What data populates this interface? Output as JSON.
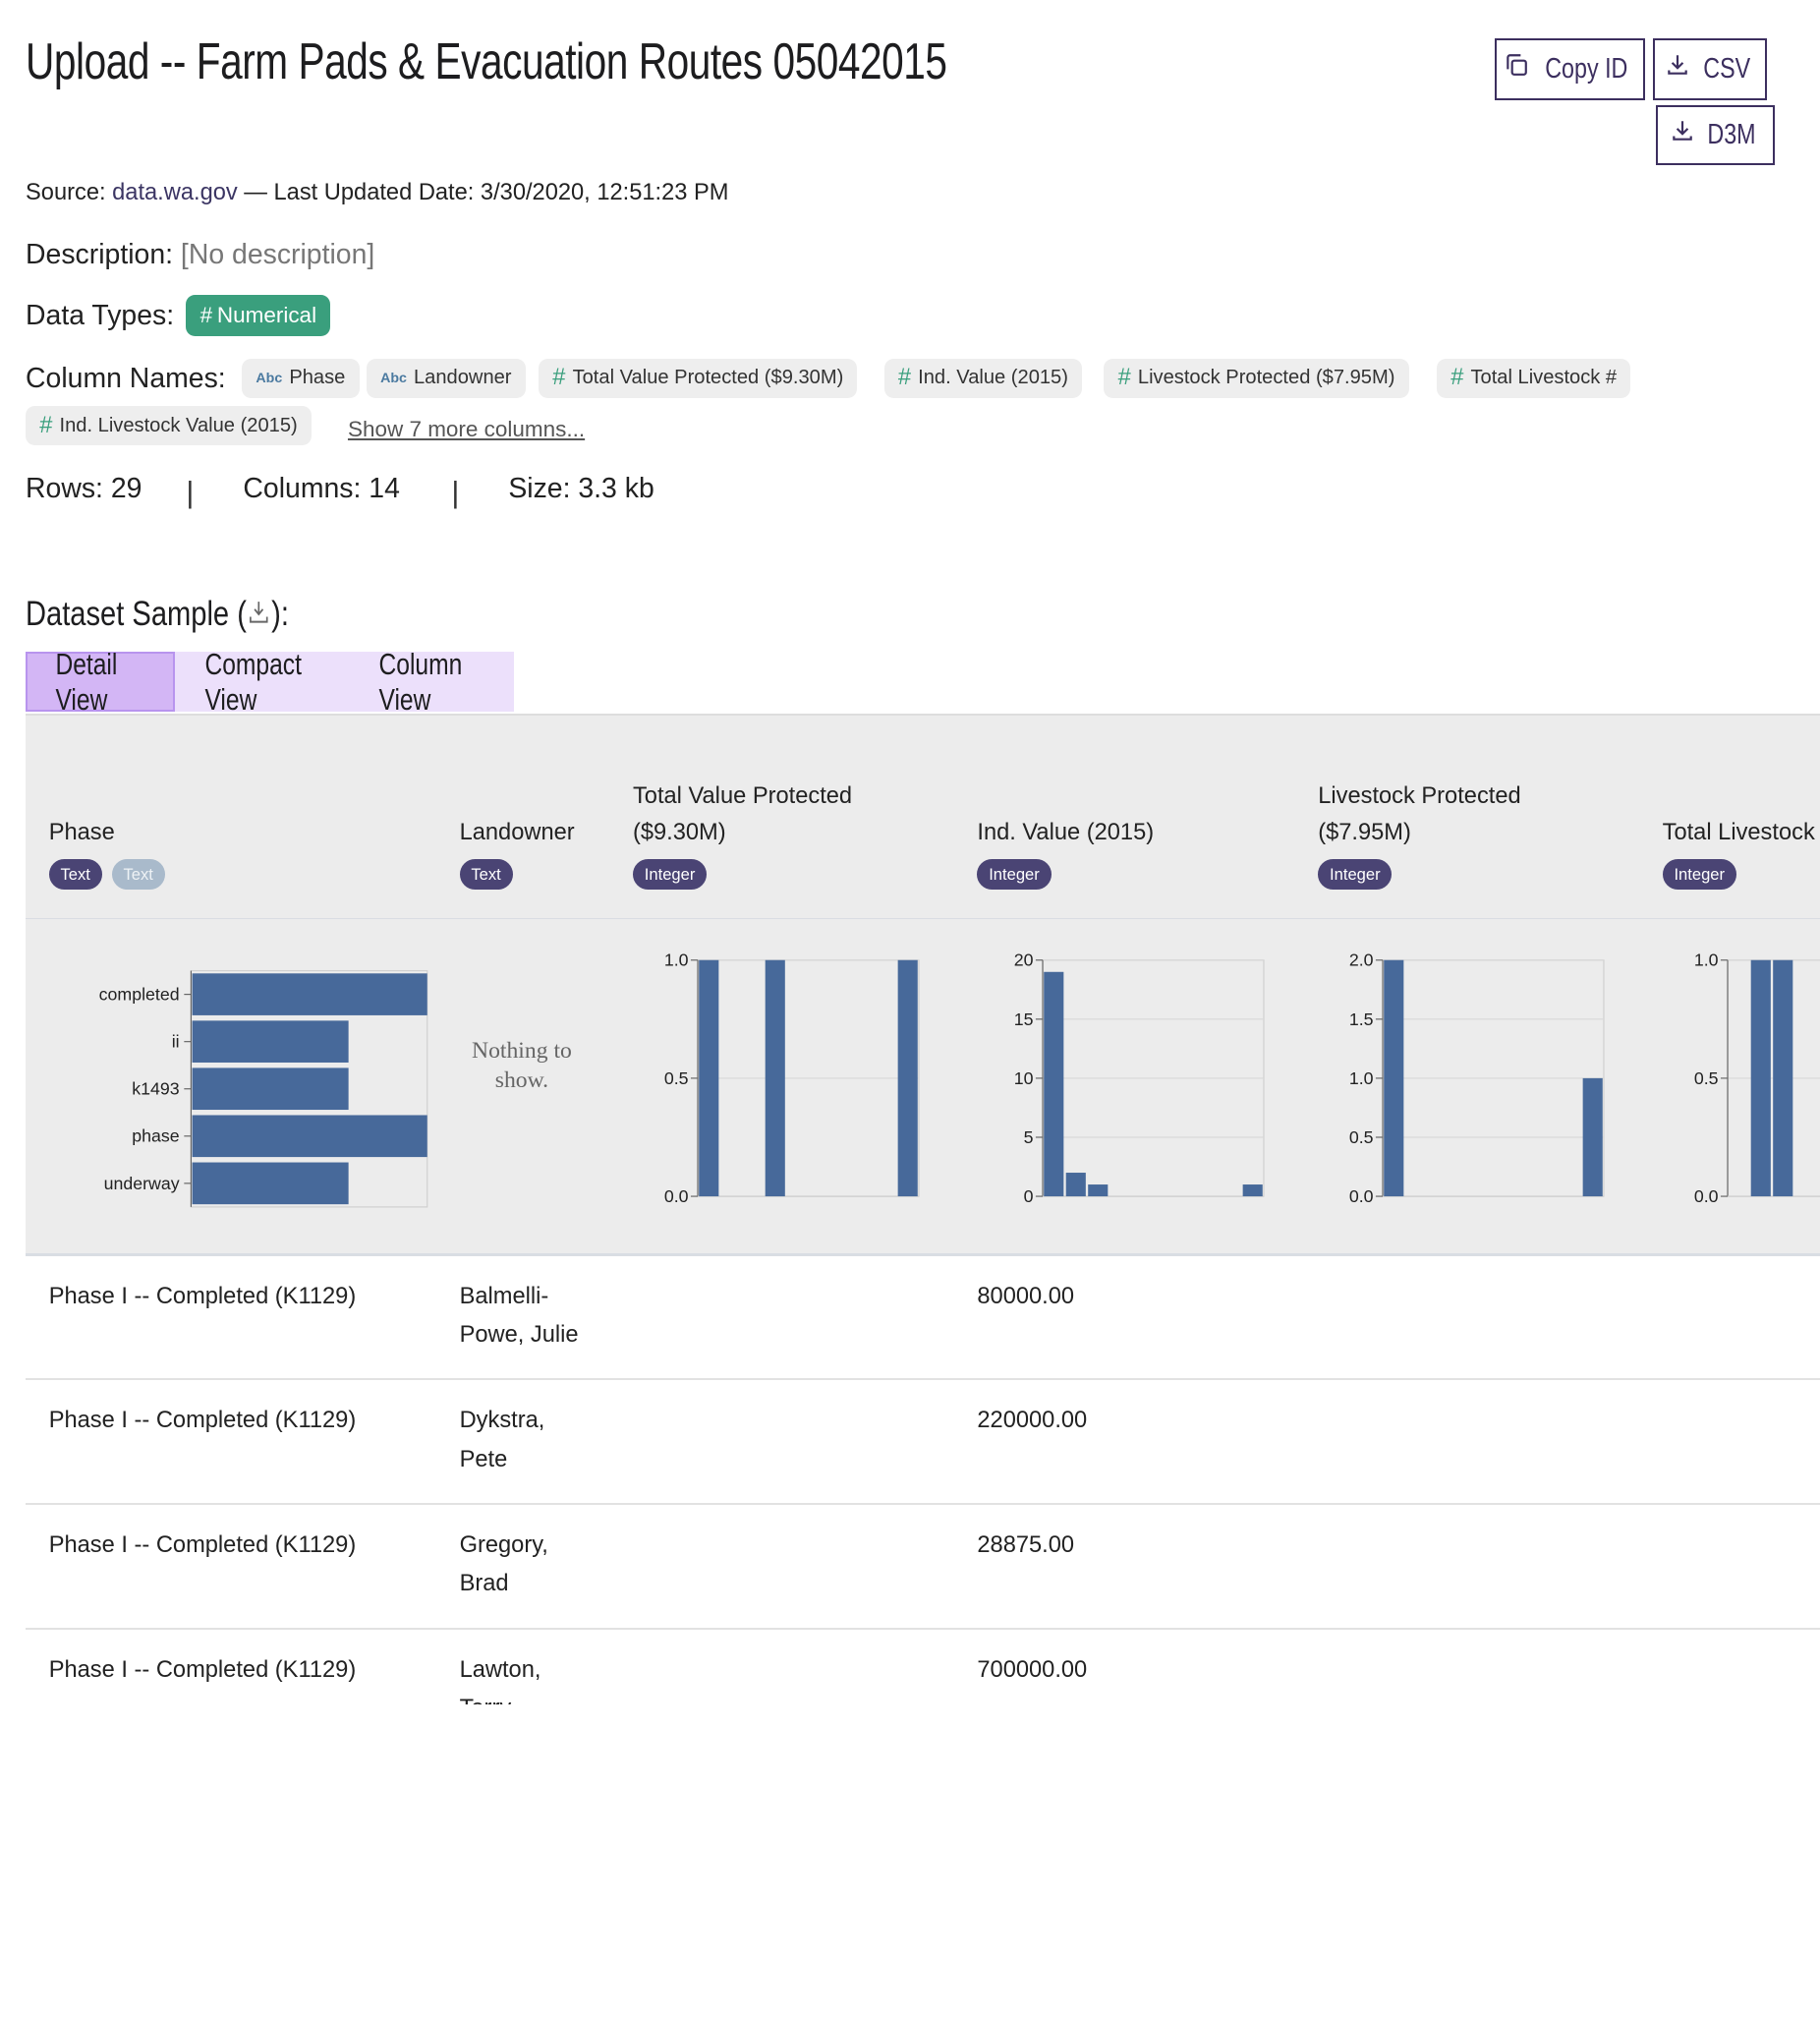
{
  "title": "Upload -- Farm Pads & Evacuation Routes 05042015",
  "buttons": {
    "copy_id": "Copy ID",
    "csv": "CSV",
    "d3m": "D3M"
  },
  "meta": {
    "source_label": "Source:",
    "source_link": "data.wa.gov",
    "updated_label": " — Last Updated Date: 3/30/2020, 12:51:23 PM",
    "description_label": "Description:",
    "description_value": "[No description]",
    "data_types_label": "Data Types:",
    "data_type": "Numerical",
    "column_names_label": "Column Names:"
  },
  "columns": [
    {
      "icon": "Abc",
      "label": "Phase"
    },
    {
      "icon": "Abc",
      "label": "Landowner"
    },
    {
      "icon": "#",
      "label": "Total Value Protected ($9.30M)"
    },
    {
      "icon": "#",
      "label": "Ind. Value (2015)"
    },
    {
      "icon": "#",
      "label": "Livestock Protected ($7.95M)"
    },
    {
      "icon": "#",
      "label": "Total Livestock #"
    },
    {
      "icon": "#",
      "label": "Ind. Livestock Value (2015)"
    }
  ],
  "more_columns": "Show 7 more columns...",
  "stats": {
    "rows": "Rows: 29",
    "columns": "Columns: 14",
    "size": "Size: 3.3 kb"
  },
  "sample_heading": "Dataset Sample (",
  "sample_heading_end": "):",
  "tabs": [
    "Detail View",
    "Compact View",
    "Column View"
  ],
  "headers": [
    {
      "line1": "",
      "line2": "Phase",
      "badges": [
        "Text",
        "Text"
      ]
    },
    {
      "line1": "",
      "line2": "Landowner",
      "badges": [
        "Text"
      ]
    },
    {
      "line1": "Total Value Protected",
      "line2": "($9.30M)",
      "badges": [
        "Integer"
      ]
    },
    {
      "line1": "",
      "line2": "Ind. Value (2015)",
      "badges": [
        "Integer"
      ]
    },
    {
      "line1": "Livestock Protected",
      "line2": "($7.95M)",
      "badges": [
        "Integer"
      ]
    },
    {
      "line1": "",
      "line2": "Total Livestock",
      "badges": [
        "Integer"
      ]
    }
  ],
  "nothing_to_show": [
    "Nothing to",
    "show."
  ],
  "chart_data": [
    {
      "type": "bar",
      "orientation": "horizontal",
      "column": "Phase",
      "categories": [
        "completed",
        "ii",
        "k1493",
        "phase",
        "underway"
      ],
      "values": [
        3,
        2,
        2,
        3,
        2
      ],
      "xlim": [
        0,
        3
      ],
      "color": "#47699a"
    },
    {
      "type": "bar",
      "column": "Total Value Protected ($9.30M)",
      "yticks": [
        "0.0",
        "0.5",
        "1.0"
      ],
      "ylim": [
        0,
        1
      ],
      "bins": 10,
      "values": [
        1,
        0,
        0,
        1,
        0,
        0,
        0,
        0,
        0,
        1
      ],
      "color": "#47699a"
    },
    {
      "type": "bar",
      "column": "Ind. Value (2015)",
      "yticks": [
        "0",
        "5",
        "10",
        "15",
        "20"
      ],
      "ylim": [
        0,
        20
      ],
      "bins": 10,
      "values": [
        19,
        2,
        1,
        0,
        0,
        0,
        0,
        0,
        0,
        1
      ],
      "color": "#47699a"
    },
    {
      "type": "bar",
      "column": "Livestock Protected ($7.95M)",
      "yticks": [
        "0.0",
        "0.5",
        "1.0",
        "1.5",
        "2.0"
      ],
      "ylim": [
        0,
        2
      ],
      "bins": 10,
      "values": [
        2,
        0,
        0,
        0,
        0,
        0,
        0,
        0,
        0,
        1
      ],
      "color": "#47699a"
    },
    {
      "type": "bar",
      "column": "Total Livestock",
      "yticks": [
        "0.0",
        "0.5",
        "1.0"
      ],
      "ylim": [
        0,
        1
      ],
      "bins": 10,
      "values": [
        0,
        1,
        1,
        0,
        0,
        0,
        0,
        0,
        0,
        0
      ],
      "color": "#47699a"
    }
  ],
  "rows": [
    {
      "phase": "Phase I -- Completed (K1129)",
      "landowner": [
        "Balmelli-",
        "Powe, Julie"
      ],
      "ind_value": "80000.00"
    },
    {
      "phase": "Phase I -- Completed (K1129)",
      "landowner": [
        "Dykstra,",
        "Pete"
      ],
      "ind_value": "220000.00"
    },
    {
      "phase": "Phase I -- Completed (K1129)",
      "landowner": [
        "Gregory,",
        "Brad"
      ],
      "ind_value": "28875.00"
    },
    {
      "phase": "Phase I -- Completed (K1129)",
      "landowner": [
        "Lawton,",
        "Terry"
      ],
      "ind_value": "700000.00"
    }
  ]
}
